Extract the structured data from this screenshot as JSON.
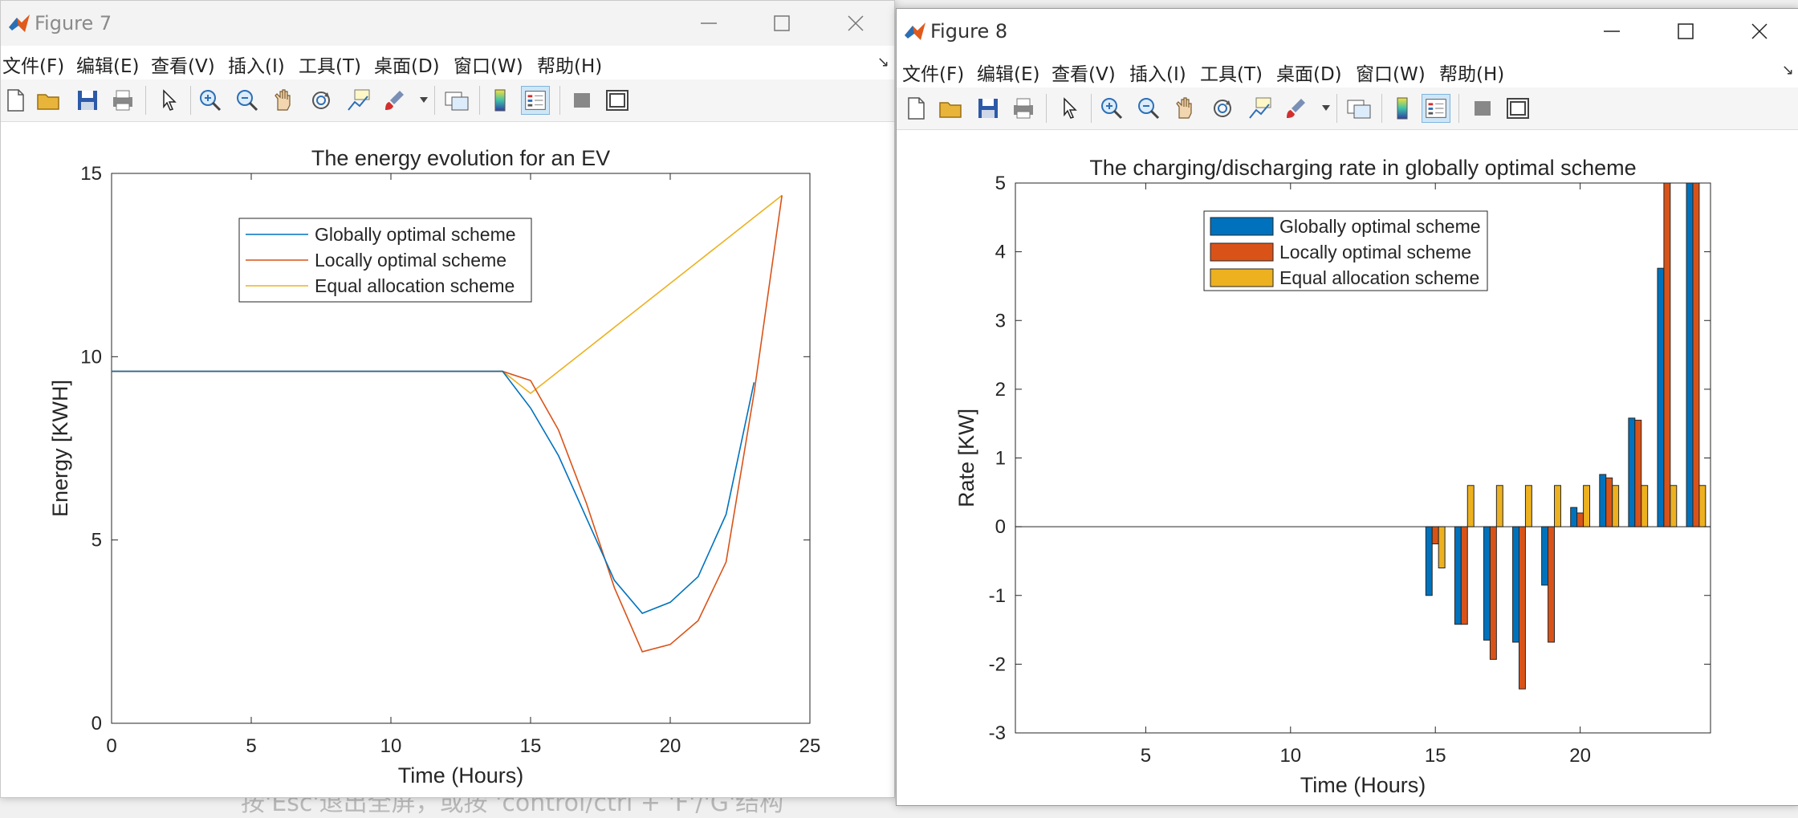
{
  "background_text": "按'Esc'退出全屏，或按 'control/ctrl + 'F'/'G'结构",
  "menus": [
    "文件(F)",
    "编辑(E)",
    "查看(V)",
    "插入(I)",
    "工具(T)",
    "桌面(D)",
    "窗口(W)",
    "帮助(H)"
  ],
  "windows": [
    {
      "title": "Figure 7"
    },
    {
      "title": "Figure 8"
    }
  ],
  "toolbar_icons": [
    "new-figure-icon",
    "open-file-icon",
    "save-icon",
    "print-icon",
    "select-arrow-icon",
    "zoom-in-icon",
    "zoom-out-icon",
    "pan-hand-icon",
    "rotate-3d-icon",
    "data-tips-icon",
    "brush-icon",
    "link-plot-icon",
    "insert-colorbar-icon",
    "insert-legend-icon",
    "hide-plot-tools-icon",
    "show-plot-tools-icon"
  ],
  "colors": {
    "blue": "#0072BD",
    "orange": "#D95319",
    "yellow": "#EDB120"
  },
  "chart_data": [
    {
      "type": "line",
      "title": "The energy evolution for an EV",
      "xlabel": "Time (Hours)",
      "ylabel": "Energy [KWH]",
      "xlim": [
        0,
        25
      ],
      "ylim": [
        0,
        15
      ],
      "xticks": [
        0,
        5,
        10,
        15,
        20,
        25
      ],
      "yticks": [
        0,
        5,
        10,
        15
      ],
      "grid": false,
      "legend_position": "top-center",
      "series": [
        {
          "name": "Globally optimal scheme",
          "color": "#0072BD",
          "x": [
            0,
            14,
            15,
            16,
            17,
            18,
            19,
            20,
            21,
            22,
            23
          ],
          "y": [
            9.6,
            9.6,
            8.6,
            7.3,
            5.6,
            3.9,
            3.0,
            3.3,
            4.0,
            5.7,
            9.3
          ]
        },
        {
          "name": "Locally optimal scheme",
          "color": "#D95319",
          "x": [
            0,
            14,
            15,
            16,
            17,
            18,
            19,
            20,
            21,
            22,
            23,
            24
          ],
          "y": [
            9.6,
            9.6,
            9.35,
            8.0,
            6.0,
            3.7,
            1.95,
            2.15,
            2.8,
            4.4,
            9.0,
            14.4
          ]
        },
        {
          "name": "Equal allocation scheme",
          "color": "#EDB120",
          "x": [
            0,
            14,
            15,
            16,
            17,
            18,
            19,
            20,
            21,
            22,
            23,
            24
          ],
          "y": [
            9.6,
            9.6,
            9.0,
            9.6,
            10.2,
            10.8,
            11.4,
            12.0,
            12.6,
            13.2,
            13.8,
            14.4
          ]
        }
      ]
    },
    {
      "type": "bar",
      "title": "The charging/discharging rate in globally optimal scheme",
      "xlabel": "Time (Hours)",
      "ylabel": "Rate [KW]",
      "xlim": [
        0.5,
        24.5
      ],
      "ylim": [
        -3,
        5
      ],
      "xticks": [
        5,
        10,
        15,
        20
      ],
      "yticks": [
        -3,
        -2,
        -1,
        0,
        1,
        2,
        3,
        4,
        5
      ],
      "grid": false,
      "legend_position": "top-center",
      "categories": [
        15,
        16,
        17,
        18,
        19,
        20,
        21,
        22,
        23,
        24
      ],
      "series": [
        {
          "name": "Globally optimal scheme",
          "color": "#0072BD",
          "values": [
            -1.0,
            -1.42,
            -1.65,
            -1.68,
            -0.85,
            0.28,
            0.76,
            1.58,
            3.76,
            5.0
          ]
        },
        {
          "name": "Locally optimal scheme",
          "color": "#D95319",
          "values": [
            -0.25,
            -1.42,
            -1.93,
            -2.36,
            -1.68,
            0.2,
            0.71,
            1.55,
            5.0,
            5.0
          ]
        },
        {
          "name": "Equal allocation scheme",
          "color": "#EDB120",
          "values": [
            -0.6,
            0.6,
            0.6,
            0.6,
            0.6,
            0.6,
            0.6,
            0.6,
            0.6,
            0.6
          ]
        }
      ]
    }
  ]
}
